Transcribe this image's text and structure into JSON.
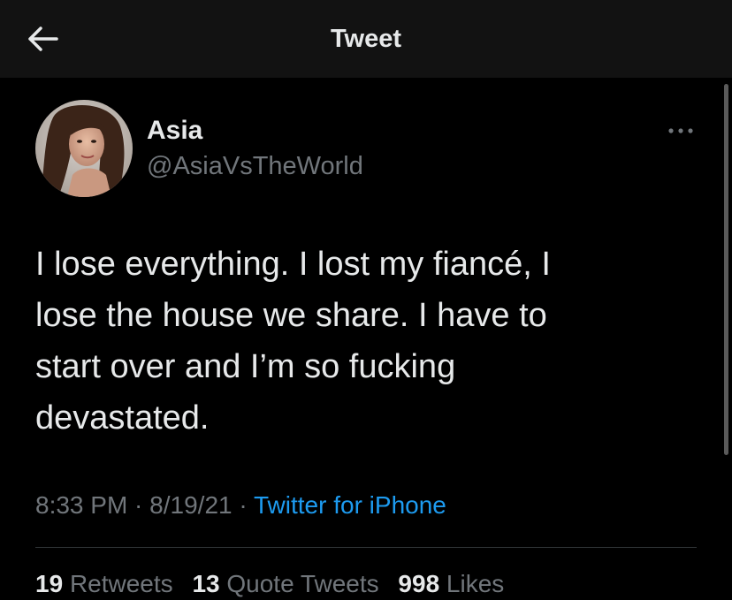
{
  "header": {
    "title": "Tweet",
    "back_icon": "arrow-left-icon"
  },
  "tweet": {
    "author": {
      "name": "Asia",
      "handle": "@AsiaVsTheWorld"
    },
    "more_icon": "more-horizontal-icon",
    "text": "I lose everything. I lost my fiancé, I\nlose the house we share. I have to\nstart over and I’m so fucking\ndevastated.",
    "time": "8:33 PM",
    "sep1": " · ",
    "date": "8/19/21",
    "sep2": " · ",
    "source": "Twitter for iPhone",
    "stats": {
      "retweets_count": "19",
      "retweets_label": "Retweets",
      "quotes_count": "13",
      "quotes_label": "Quote Tweets",
      "likes_count": "998",
      "likes_label": "Likes"
    }
  },
  "colors": {
    "background": "#000000",
    "header_bg": "#121212",
    "text_primary": "#e7e9ea",
    "text_secondary": "#71767b",
    "link": "#1d9bf0",
    "divider": "#2f3336"
  }
}
